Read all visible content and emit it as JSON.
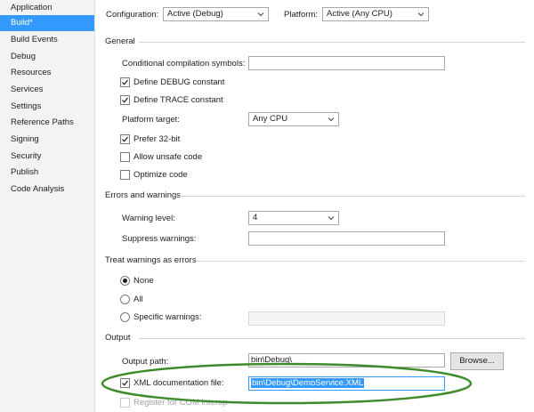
{
  "sidebar": {
    "items": [
      {
        "label": "Application"
      },
      {
        "label": "Build*"
      },
      {
        "label": "Build Events"
      },
      {
        "label": "Debug"
      },
      {
        "label": "Resources"
      },
      {
        "label": "Services"
      },
      {
        "label": "Settings"
      },
      {
        "label": "Reference Paths"
      },
      {
        "label": "Signing"
      },
      {
        "label": "Security"
      },
      {
        "label": "Publish"
      },
      {
        "label": "Code Analysis"
      }
    ],
    "selected_index": 1
  },
  "toolbar": {
    "configuration_label": "Configuration:",
    "configuration_value": "Active (Debug)",
    "platform_label": "Platform:",
    "platform_value": "Active (Any CPU)"
  },
  "general": {
    "header": "General",
    "conditional_symbols_label": "Conditional compilation symbols:",
    "conditional_symbols_value": "",
    "define_debug_label": "Define DEBUG constant",
    "define_debug_checked": true,
    "define_trace_label": "Define TRACE constant",
    "define_trace_checked": true,
    "platform_target_label": "Platform target:",
    "platform_target_value": "Any CPU",
    "prefer32_label": "Prefer 32-bit",
    "prefer32_checked": true,
    "allow_unsafe_label": "Allow unsafe code",
    "allow_unsafe_checked": false,
    "optimize_label": "Optimize code",
    "optimize_checked": false
  },
  "errors": {
    "header": "Errors and warnings",
    "warning_level_label": "Warning level:",
    "warning_level_value": "4",
    "suppress_label": "Suppress warnings:",
    "suppress_value": ""
  },
  "treat": {
    "header": "Treat warnings as errors",
    "none_label": "None",
    "all_label": "All",
    "specific_label": "Specific warnings:",
    "selected": "None",
    "specific_value": ""
  },
  "output": {
    "header": "Output",
    "path_label": "Output path:",
    "path_value": "bin\\Debug\\",
    "browse_label": "Browse...",
    "xml_doc_label": "XML documentation file:",
    "xml_doc_checked": true,
    "xml_doc_value": "bin\\Debug\\DemoService.XML",
    "register_com_label": "Register for COM interop",
    "register_com_checked": false
  },
  "colors": {
    "selection": "#3399ff",
    "annotation": "#3d8b2a"
  }
}
